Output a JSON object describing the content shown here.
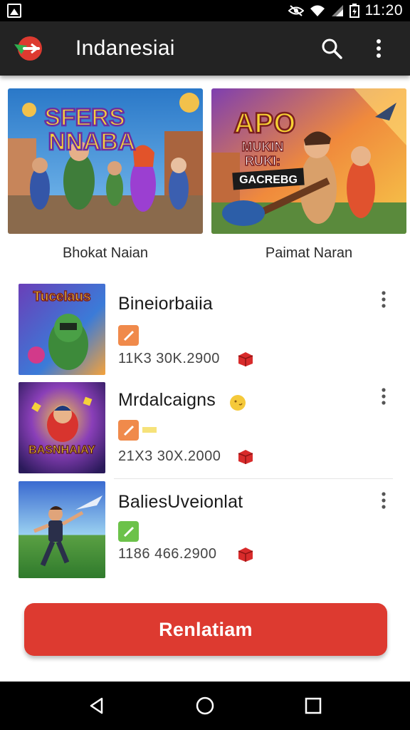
{
  "status_bar": {
    "time": "11:20"
  },
  "app_bar": {
    "title": "Indanesiai",
    "logo_icon": "app-logo-icon",
    "search_icon": "search-icon",
    "more_icon": "more-vert-icon"
  },
  "featured": [
    {
      "label": "Bhokat Naian",
      "art_text": [
        "SFERS",
        "NNABA"
      ]
    },
    {
      "label": "Paimat Naran",
      "art_text": [
        "APO",
        "MUKIN",
        "RUKI:",
        "GACREBG"
      ]
    }
  ],
  "list": [
    {
      "title": "Bineiorbaiia",
      "meta": "11K3 30K.2900",
      "thumb_text": "Tucelaus",
      "badge_color": "#f08a4b"
    },
    {
      "title": "Mrdalcaigns",
      "meta": "21X3 30X.2000",
      "thumb_text": "BASNHAIAY",
      "badge_color": "#f08a4b"
    },
    {
      "title": "BaliesUveionlat",
      "meta": "1186 466.2900",
      "thumb_text": "",
      "badge_color": "#6cc24a"
    }
  ],
  "cta": {
    "label": "Renlatiam"
  },
  "colors": {
    "accent": "#dd3a30",
    "app_bar": "#232323"
  }
}
